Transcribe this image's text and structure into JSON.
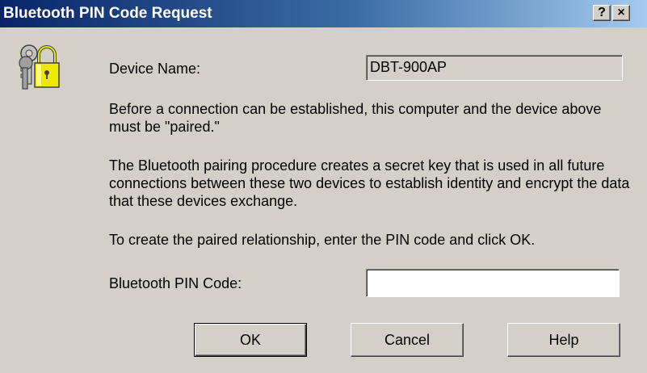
{
  "window": {
    "title": "Bluetooth PIN Code Request",
    "help_button": "?",
    "close_button": "×"
  },
  "icons": {
    "dialog_icon": "keys-and-padlock-icon"
  },
  "device": {
    "label": "Device Name:",
    "value": "DBT-900AP"
  },
  "messages": {
    "paragraph1": "Before a connection can be established, this computer and the device above must be \"paired.\"",
    "paragraph2": "The Bluetooth pairing procedure creates a secret key that is used in all future connections between these two devices to establish identity and encrypt the data that these devices exchange.",
    "paragraph3": "To create the paired relationship, enter the PIN code and click OK."
  },
  "pin": {
    "label": "Bluetooth PIN Code:",
    "value": ""
  },
  "buttons": {
    "ok": "OK",
    "cancel": "Cancel",
    "help": "Help"
  },
  "colors": {
    "title_start": "#0a246a",
    "title_end": "#a6caf0",
    "dialog_bg": "#d4d0c8"
  }
}
